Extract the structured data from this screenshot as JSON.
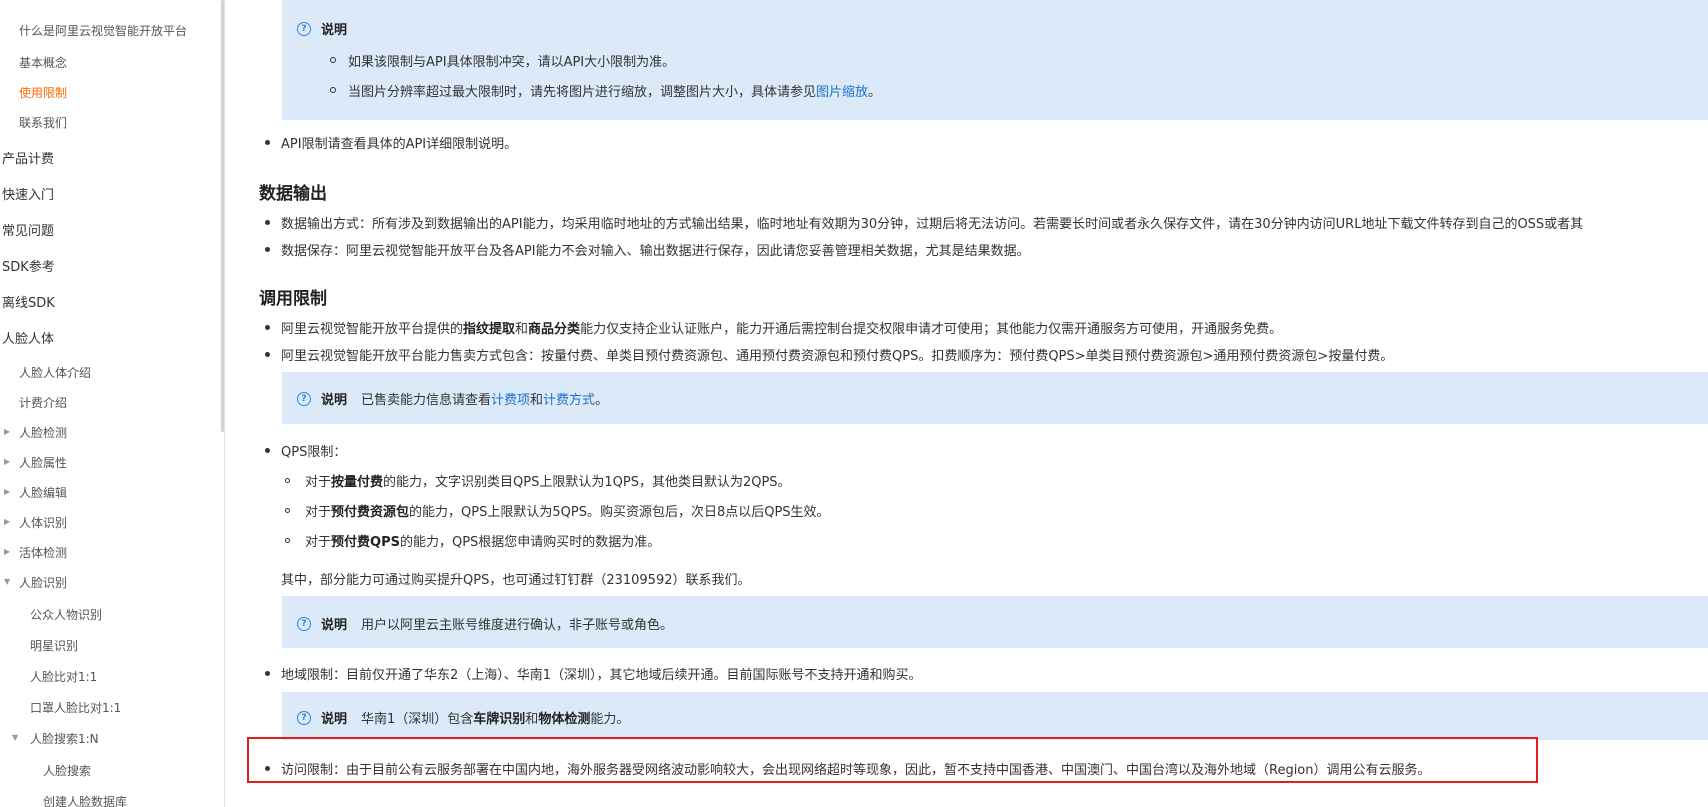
{
  "sidebar": {
    "items": [
      {
        "label": "什么是阿里云视觉智能开放平台",
        "level": 2
      },
      {
        "label": "基本概念",
        "level": 2
      },
      {
        "label": "使用限制",
        "level": 2,
        "active": true
      },
      {
        "label": "联系我们",
        "level": 2
      },
      {
        "label": "产品计费",
        "level": 1
      },
      {
        "label": "快速入门",
        "level": 1
      },
      {
        "label": "常见问题",
        "level": 1
      },
      {
        "label": "SDK参考",
        "level": 1
      },
      {
        "label": "离线SDK",
        "level": 1
      },
      {
        "label": "人脸人体",
        "level": 1
      },
      {
        "label": "人脸人体介绍",
        "level": 2
      },
      {
        "label": "计费介绍",
        "level": 2
      },
      {
        "label": "人脸检测",
        "level": 2
      },
      {
        "label": "人脸属性",
        "level": 2
      },
      {
        "label": "人脸编辑",
        "level": 2
      },
      {
        "label": "人体识别",
        "level": 2
      },
      {
        "label": "活体检测",
        "level": 2
      },
      {
        "label": "人脸识别",
        "level": 2
      },
      {
        "label": "公众人物识别",
        "level": 3
      },
      {
        "label": "明星识别",
        "level": 3
      },
      {
        "label": "人脸比对1:1",
        "level": 3
      },
      {
        "label": "口罩人脸比对1:1",
        "level": 3
      },
      {
        "label": "人脸搜索1:N",
        "level": 3
      },
      {
        "label": "人脸搜索",
        "level": 4
      },
      {
        "label": "创建人脸数据库",
        "level": 4
      }
    ]
  },
  "icons": {
    "note": "question-circle-icon",
    "expand": "triangle-right-icon",
    "collapse": "triangle-down-icon"
  },
  "colors": {
    "accent": "#ff6a00",
    "link": "#1a73c9",
    "note_bg": "#dbe9f8",
    "highlight": "#e02020"
  },
  "content": {
    "note1": {
      "label": "说明",
      "b1": "如果该限制与API具体限制冲突，请以API大小限制为准。",
      "b2_pre": "当图片分辨率超过最大限制时，请先将图片进行缩放，调整图片大小，具体请参见",
      "b2_link": "图片缩放",
      "b2_post": "。"
    },
    "api_note": "API限制请查看具体的API详细限制说明。",
    "section_output": {
      "title": "数据输出",
      "b1": "数据输出方式：所有涉及到数据输出的API能力，均采用临时地址的方式输出结果，临时地址有效期为30分钟，过期后将无法访问。若需要长时间或者永久保存文件，请在30分钟内访问URL地址下载文件转存到自己的OSS或者其",
      "b2": "数据保存：阿里云视觉智能开放平台及各API能力不会对输入、输出数据进行保存，因此请您妥善管理相关数据，尤其是结果数据。"
    },
    "section_limits": {
      "title": "调用限制",
      "b1_pre": "阿里云视觉智能开放平台提供的",
      "b1_bold1": "指纹提取",
      "b1_mid": "和",
      "b1_bold2": "商品分类",
      "b1_post": "能力仅支持企业认证账户，能力开通后需控制台提交权限申请才可使用；其他能力仅需开通服务方可使用，开通服务免费。",
      "b2": "阿里云视觉智能开放平台能力售卖方式包含：按量付费、单类目预付费资源包、通用预付费资源包和预付费QPS。扣费顺序为：预付费QPS>单类目预付费资源包>通用预付费资源包>按量付费。",
      "note2_label": "说明",
      "note2_pre": "已售卖能力信息请查看",
      "note2_link1": "计费项",
      "note2_mid": "和",
      "note2_link2": "计费方式",
      "note2_post": "。",
      "qps_title": "QPS限制：",
      "qps1_pre": "对于",
      "qps1_bold": "按量付费",
      "qps1_post": "的能力，文字识别类目QPS上限默认为1QPS，其他类目默认为2QPS。",
      "qps2_pre": "对于",
      "qps2_bold": "预付费资源包",
      "qps2_post": "的能力，QPS上限默认为5QPS。购买资源包后，次日8点以后QPS生效。",
      "qps3_pre": "对于",
      "qps3_bold": "预付费QPS",
      "qps3_post": "的能力，QPS根据您申请购买时的数据为准。",
      "qps_extra": "其中，部分能力可通过购买提升QPS，也可通过钉钉群（23109592）联系我们。",
      "note3_label": "说明",
      "note3_text": "用户以阿里云主账号维度进行确认，非子账号或角色。",
      "region": "地域限制：目前仅开通了华东2（上海）、华南1（深圳），其它地域后续开通。目前国际账号不支持开通和购买。",
      "note4_label": "说明",
      "note4_pre": "华南1（深圳）包含",
      "note4_bold1": "车牌识别",
      "note4_mid": "和",
      "note4_bold2": "物体检测",
      "note4_post": "能力。",
      "access": "访问限制：由于目前公有云服务部署在中国内地，海外服务器受网络波动影响较大，会出现网络超时等现象，因此，暂不支持中国香港、中国澳门、中国台湾以及海外地域（Region）调用公有云服务。"
    }
  }
}
